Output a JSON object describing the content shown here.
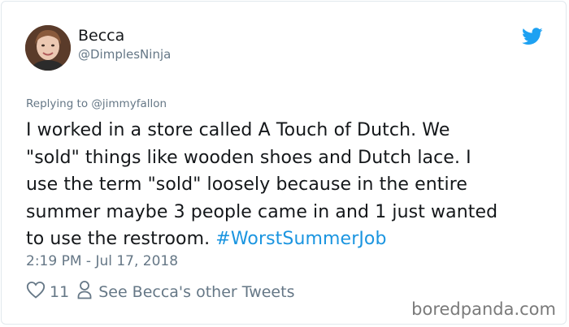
{
  "tweet": {
    "author_name": "Becca",
    "author_handle": "@DimplesNinja",
    "replying_label": "Replying to",
    "replying_handle": "@jimmyfallon",
    "text_lines": [
      "I worked in a store called A Touch of Dutch. We",
      "\"sold\" things like wooden shoes and Dutch lace. I",
      "use the term \"sold\" loosely because in the entire",
      "summer maybe 3 people came in and 1 just wanted",
      "to use the restroom. "
    ],
    "hashtag": "#WorstSummerJob",
    "timestamp": "2:19 PM - Jul 17, 2018",
    "like_count": "11",
    "other_tweets_label": "See Becca's other Tweets"
  },
  "watermark": "boredpanda.com",
  "icons": {
    "brand": "twitter-bird-icon",
    "like": "heart-icon",
    "profile": "person-icon"
  },
  "colors": {
    "twitter_blue": "#1da1f2",
    "hashtag": "#1b95e0",
    "secondary_text": "#657786"
  }
}
